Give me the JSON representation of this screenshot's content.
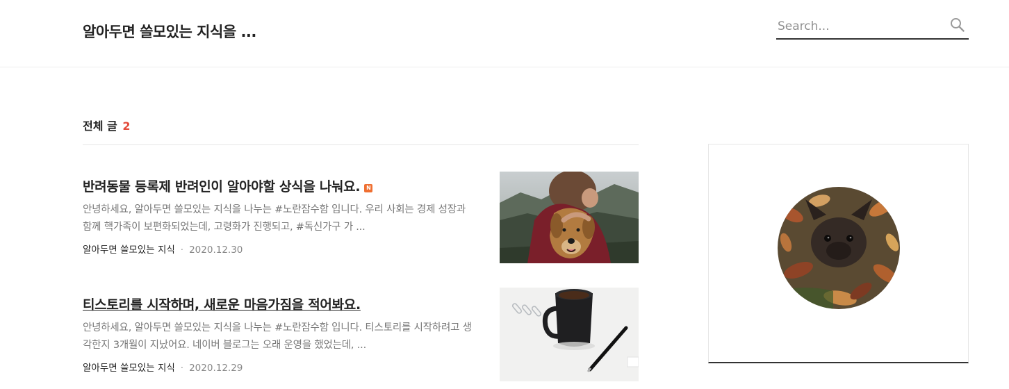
{
  "header": {
    "site_title": "알아두면 쓸모있는 지식을 ...",
    "search_placeholder": "Search...",
    "search_icon": "search-icon"
  },
  "list": {
    "heading": "전체 글",
    "count": "2"
  },
  "posts": [
    {
      "title": "반려동물 등록제 반려인이 알아야할 상식을 나눠요.",
      "badge": "N",
      "summary": "안녕하세요, 알아두면 쓸모있는 지식을 나누는 #노란잠수함 입니다. 우리 사회는 경제 성장과 함께 핵가족이 보편화되었는데, 고령화가 진행되고, #독신가구 가 ...",
      "category": "알아두면 쓸모있는 지식",
      "separator": "·",
      "date": "2020.12.30"
    },
    {
      "title": "티스토리를 시작하며, 새로운 마음가짐을 적어봐요.",
      "summary": "안녕하세요, 알아두면 쓸모있는 지식을 나누는 #노란잠수함 입니다. 티스토리를 시작하려고 생각한지 3개월이 지났어요. 네이버 블로그는 오래 운영을 했었는데, ...",
      "category": "알아두면 쓸모있는 지식",
      "separator": "·",
      "date": "2020.12.29"
    }
  ],
  "colors": {
    "accent_count": "#e34c3c",
    "new_badge": "#ef6f31",
    "text_dark": "#222222",
    "text_muted": "#777777"
  }
}
